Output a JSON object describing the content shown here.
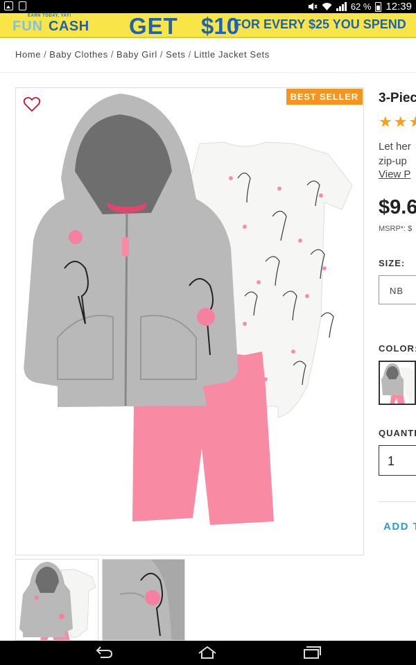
{
  "status_bar": {
    "battery": "62 %",
    "time": "12:39",
    "icons": [
      "image-icon",
      "document-icon",
      "mute-icon",
      "wifi-icon",
      "signal-icon",
      "battery-icon"
    ]
  },
  "banner": {
    "small_text": "EARN TODAY, YAY!",
    "fun": "FUN",
    "cash": "CASH",
    "get": "GET",
    "amount": "$10",
    "rest": "FOR EVERY $25 YOU SPEND"
  },
  "breadcrumb": {
    "items": [
      "Home",
      "Baby Clothes",
      "Baby Girl",
      "Sets",
      "Little Jacket Sets"
    ]
  },
  "product": {
    "badge": "BEST SELLER",
    "title": "3-Piec",
    "stars": "★★★",
    "desc_line1": "Let her",
    "desc_line2": "zip-up",
    "view_link": "View P",
    "price": "$9.6",
    "msrp": "MSRP*: $"
  },
  "options": {
    "size_label": "SIZE:",
    "size_value": "NB",
    "color_label": "COLOR:",
    "quantity_label": "QUANTI",
    "quantity_value": "1",
    "add_button": "ADD T"
  },
  "colors": {
    "accent_blue": "#2a9bd6",
    "badge_orange": "#f7941d",
    "star_orange": "#f7a11a",
    "banner_yellow": "#f9e547"
  }
}
